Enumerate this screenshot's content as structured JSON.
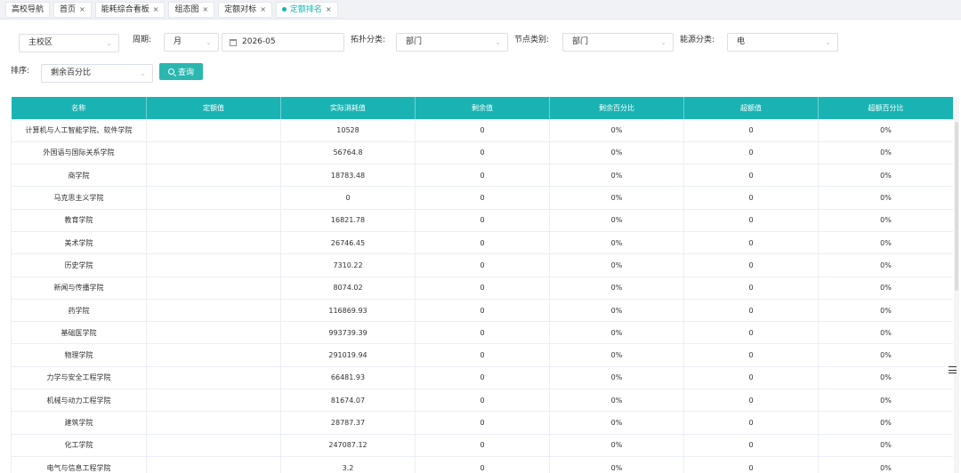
{
  "tabs": [
    {
      "label": "高校导航",
      "closable": false,
      "active": false
    },
    {
      "label": "首页",
      "closable": true,
      "active": false
    },
    {
      "label": "能耗综合看板",
      "closable": true,
      "active": false
    },
    {
      "label": "组态图",
      "closable": true,
      "active": false
    },
    {
      "label": "定额对标",
      "closable": true,
      "active": false
    },
    {
      "label": "定额排名",
      "closable": true,
      "active": true
    }
  ],
  "filters": {
    "campus": "主校区",
    "period_label": "周期:",
    "period_value": "月",
    "date_value": "2026-05",
    "topology_label": "拓扑分类:",
    "topology_value": "部门",
    "node_label": "节点类别:",
    "node_value": "部门",
    "energy_label": "能源分类:",
    "energy_value": "电",
    "sort_label": "排序:",
    "sort_value": "剩余百分比",
    "query_button": "查询"
  },
  "table": {
    "columns": [
      "名称",
      "定额值",
      "实际消耗值",
      "剩余值",
      "剩余百分比",
      "超额值",
      "超额百分比"
    ],
    "rows": [
      [
        "计算机与人工智能学院、软件学院",
        "",
        "10528",
        "0",
        "0%",
        "0",
        "0%"
      ],
      [
        "外国语与国际关系学院",
        "",
        "56764.8",
        "0",
        "0%",
        "0",
        "0%"
      ],
      [
        "商学院",
        "",
        "18783.48",
        "0",
        "0%",
        "0",
        "0%"
      ],
      [
        "马克思主义学院",
        "",
        "0",
        "0",
        "0%",
        "0",
        "0%"
      ],
      [
        "教育学院",
        "",
        "16821.78",
        "0",
        "0%",
        "0",
        "0%"
      ],
      [
        "美术学院",
        "",
        "26746.45",
        "0",
        "0%",
        "0",
        "0%"
      ],
      [
        "历史学院",
        "",
        "7310.22",
        "0",
        "0%",
        "0",
        "0%"
      ],
      [
        "新闻与传播学院",
        "",
        "8074.02",
        "0",
        "0%",
        "0",
        "0%"
      ],
      [
        "药学院",
        "",
        "116869.93",
        "0",
        "0%",
        "0",
        "0%"
      ],
      [
        "基础医学院",
        "",
        "993739.39",
        "0",
        "0%",
        "0",
        "0%"
      ],
      [
        "物理学院",
        "",
        "291019.94",
        "0",
        "0%",
        "0",
        "0%"
      ],
      [
        "力学与安全工程学院",
        "",
        "66481.93",
        "0",
        "0%",
        "0",
        "0%"
      ],
      [
        "机械与动力工程学院",
        "",
        "81674.07",
        "0",
        "0%",
        "0",
        "0%"
      ],
      [
        "建筑学院",
        "",
        "28787.37",
        "0",
        "0%",
        "0",
        "0%"
      ],
      [
        "化工学院",
        "",
        "247087.12",
        "0",
        "0%",
        "0",
        "0%"
      ],
      [
        "电气与信息工程学院",
        "",
        "3.2",
        "0",
        "0%",
        "0",
        "0%"
      ]
    ]
  },
  "icons": {
    "tab_close": "close-icon",
    "active_tab_marker": "dot-icon",
    "select_arrow": "chevron-down-icon",
    "date": "calendar-icon",
    "query": "search-icon",
    "side_handle": "sliders-icon"
  },
  "colors": {
    "accent": "#1ab3b3",
    "button": "#2ab7b0"
  }
}
